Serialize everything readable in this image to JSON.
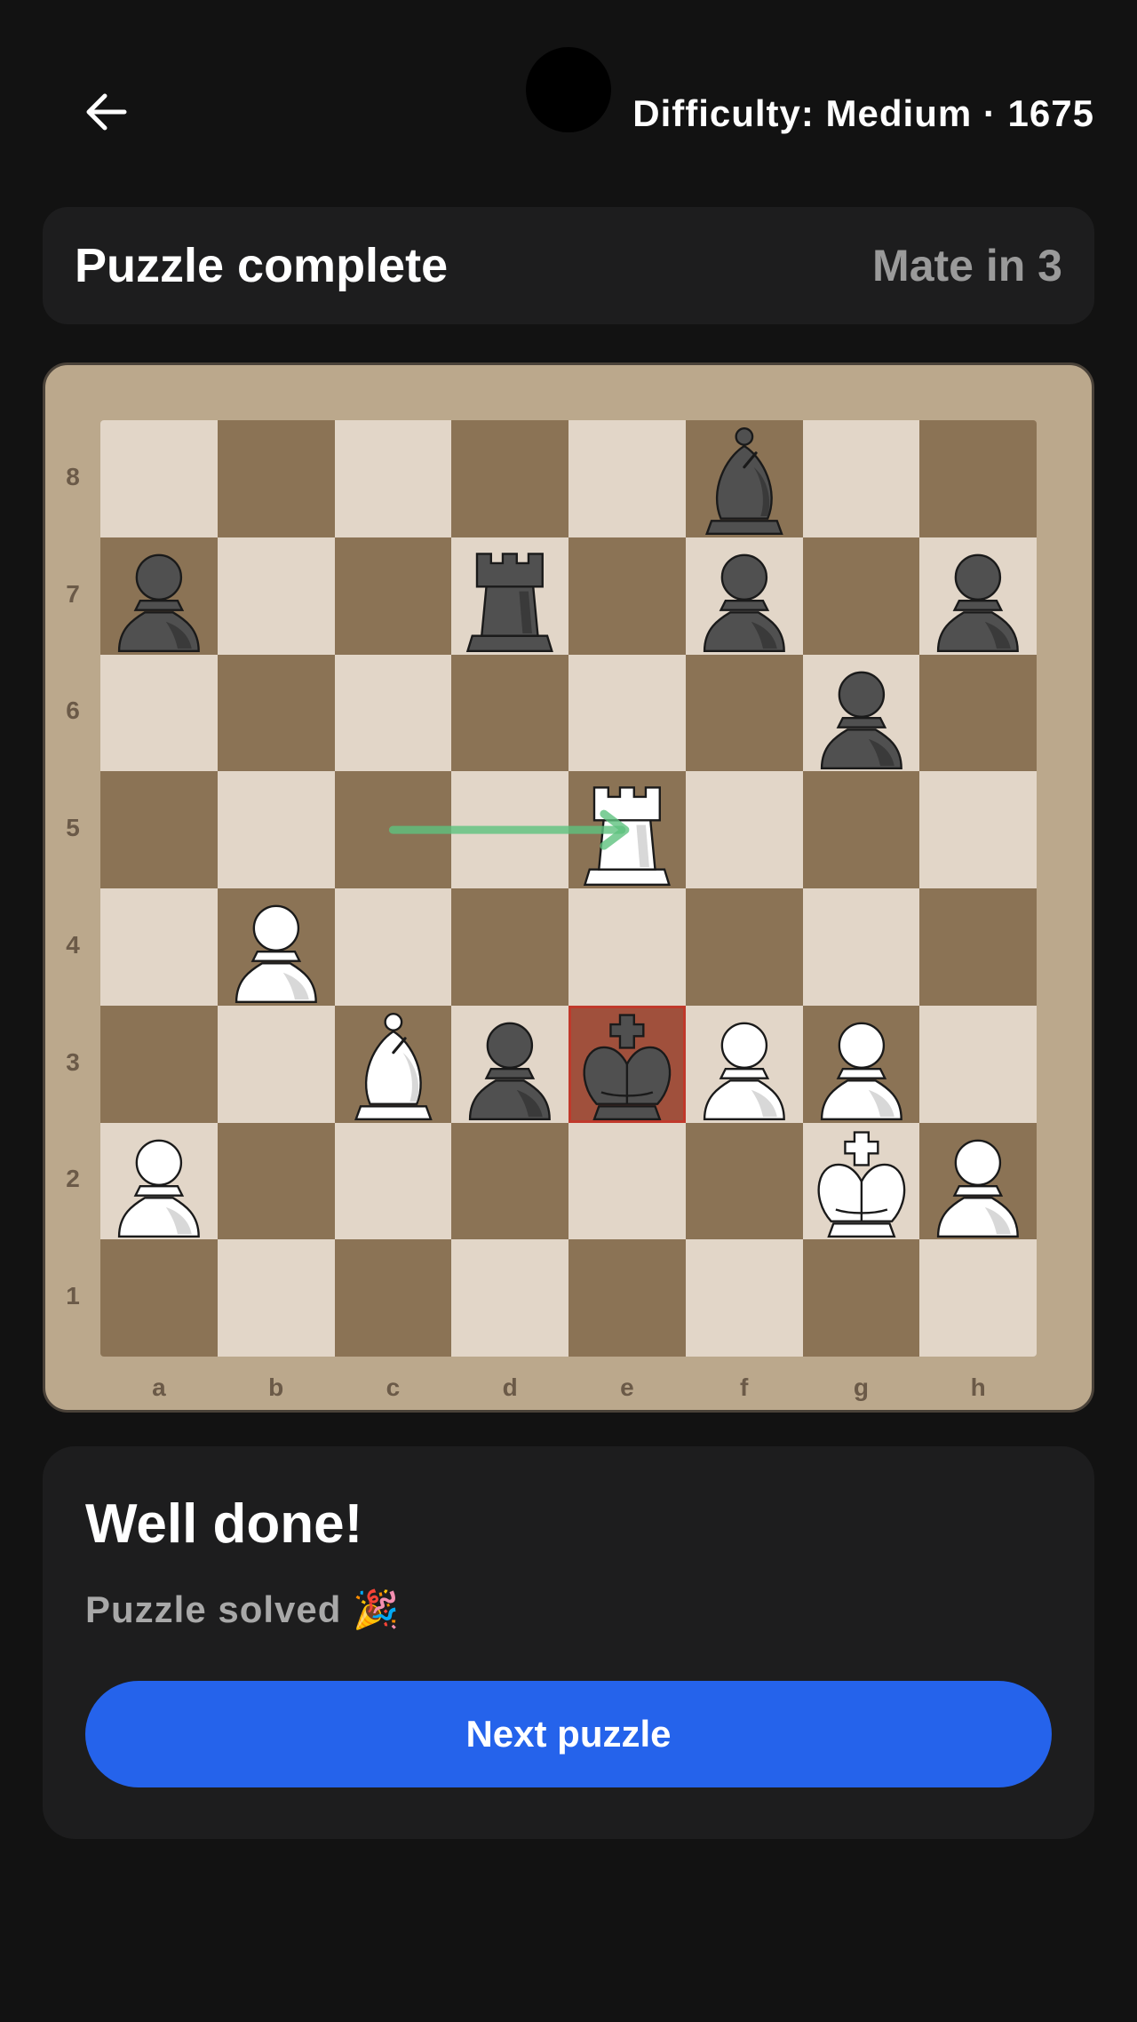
{
  "header": {
    "back_icon": "arrow-left-icon",
    "difficulty_text": "Difficulty: Medium · 1675"
  },
  "status": {
    "title": "Puzzle complete",
    "goal": "Mate in 3"
  },
  "board": {
    "ranks": [
      "8",
      "7",
      "6",
      "5",
      "4",
      "3",
      "2",
      "1"
    ],
    "files": [
      "a",
      "b",
      "c",
      "d",
      "e",
      "f",
      "g",
      "h"
    ],
    "pieces": [
      {
        "square": "f8",
        "piece": "bB"
      },
      {
        "square": "a7",
        "piece": "bP"
      },
      {
        "square": "d7",
        "piece": "bR"
      },
      {
        "square": "f7",
        "piece": "bP"
      },
      {
        "square": "h7",
        "piece": "bP"
      },
      {
        "square": "g6",
        "piece": "bP"
      },
      {
        "square": "e5",
        "piece": "wR"
      },
      {
        "square": "b4",
        "piece": "wP"
      },
      {
        "square": "c3",
        "piece": "wB"
      },
      {
        "square": "d3",
        "piece": "bP"
      },
      {
        "square": "e3",
        "piece": "bK"
      },
      {
        "square": "f3",
        "piece": "wP"
      },
      {
        "square": "g3",
        "piece": "wP"
      },
      {
        "square": "a2",
        "piece": "wP"
      },
      {
        "square": "g2",
        "piece": "wK"
      },
      {
        "square": "h2",
        "piece": "wP"
      }
    ],
    "highlight_square": "e3",
    "last_move": {
      "from": "c5",
      "to": "e5"
    },
    "colors": {
      "light_square": "#e2d6c8",
      "dark_square": "#8b7355",
      "highlight": "#a0503c",
      "arrow": "#5ec27e"
    }
  },
  "result": {
    "title": "Well done!",
    "subtitle": "Puzzle solved 🎉",
    "button_label": "Next puzzle",
    "button_color": "#2563eb"
  }
}
